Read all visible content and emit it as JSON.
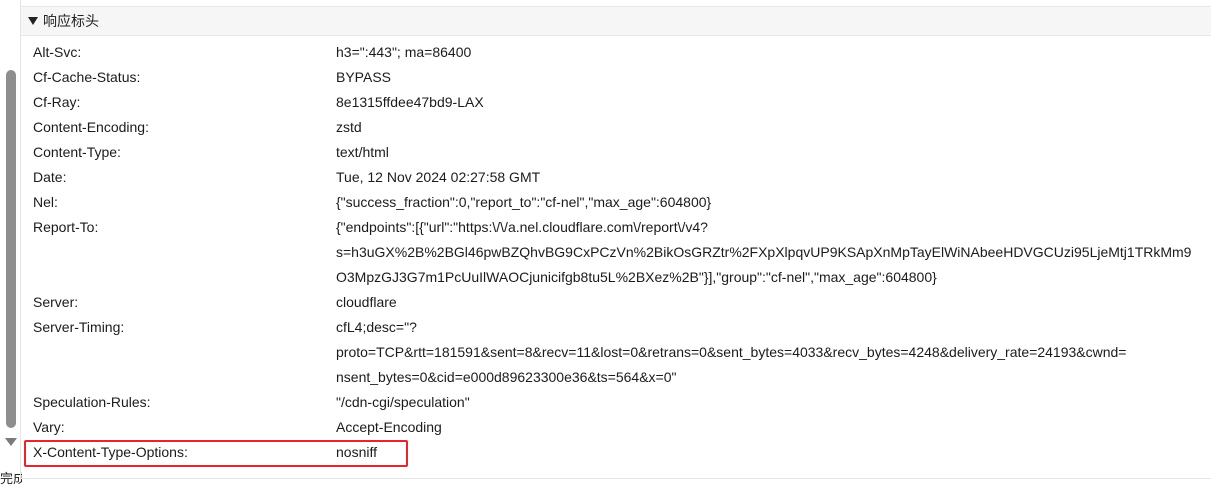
{
  "status": {
    "text": "完成"
  },
  "section": {
    "title": "响应标头"
  },
  "headers": [
    {
      "name": "Alt-Svc:",
      "value": [
        "h3=\":443\"; ma=86400"
      ]
    },
    {
      "name": "Cf-Cache-Status:",
      "value": [
        "BYPASS"
      ]
    },
    {
      "name": "Cf-Ray:",
      "value": [
        "8e1315ffdee47bd9-LAX"
      ]
    },
    {
      "name": "Content-Encoding:",
      "value": [
        "zstd"
      ]
    },
    {
      "name": "Content-Type:",
      "value": [
        "text/html"
      ]
    },
    {
      "name": "Date:",
      "value": [
        "Tue, 12 Nov 2024 02:27:58 GMT"
      ]
    },
    {
      "name": "Nel:",
      "value": [
        "{\"success_fraction\":0,\"report_to\":\"cf-nel\",\"max_age\":604800}"
      ]
    },
    {
      "name": "Report-To:",
      "value": [
        "{\"endpoints\":[{\"url\":\"https:\\/\\/a.nel.cloudflare.com\\/report\\/v4?",
        "s=h3uGX%2B%2BGl46pwBZQhvBG9CxPCzVn%2BikOsGRZtr%2FXpXlpqvUP9KSApXnMpTayElWiNAbeeHDVGCUzi95LjeMtj1TRkMm9",
        "O3MpzGJ3G7m1PcUuIlWAOCjunicifgb8tu5L%2BXez%2B\"}],\"group\":\"cf-nel\",\"max_age\":604800}"
      ]
    },
    {
      "name": "Server:",
      "value": [
        "cloudflare"
      ]
    },
    {
      "name": "Server-Timing:",
      "value": [
        "cfL4;desc=\"?",
        "proto=TCP&rtt=181591&sent=8&recv=11&lost=0&retrans=0&sent_bytes=4033&recv_bytes=4248&delivery_rate=24193&cwnd=",
        "nsent_bytes=0&cid=e000d89623300e36&ts=564&x=0\""
      ]
    },
    {
      "name": "Speculation-Rules:",
      "value": [
        "\"/cdn-cgi/speculation\""
      ]
    },
    {
      "name": "Vary:",
      "value": [
        "Accept-Encoding"
      ]
    },
    {
      "name": "X-Content-Type-Options:",
      "value": [
        "nosniff"
      ],
      "highlighted": true
    }
  ],
  "colors": {
    "highlight": "#e8262a",
    "header_bg": "#f6f6f6",
    "scroll_thumb": "#8e8e8e"
  }
}
